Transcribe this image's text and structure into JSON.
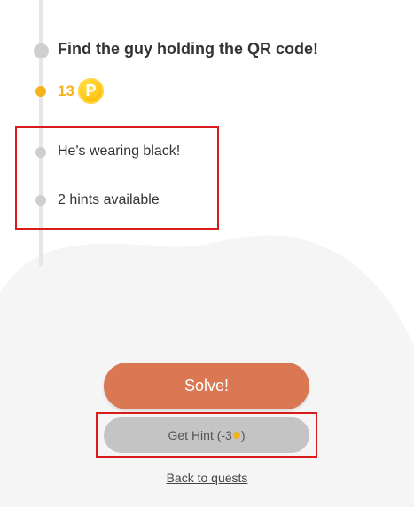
{
  "quest": {
    "task_title": "Find the guy holding the QR code!",
    "coins": "13",
    "coin_icon_glyph": "P"
  },
  "hints": {
    "items": [
      {
        "text": "He's wearing black!"
      },
      {
        "text": "2 hints available"
      }
    ]
  },
  "actions": {
    "solve_label": "Solve!",
    "hint_label_prefix": "Get Hint (-3",
    "hint_label_suffix": ")",
    "back_label": "Back to quests"
  },
  "colors": {
    "accent": "#d97852",
    "coin": "#f5b21a",
    "highlight": "#d81b1b",
    "disabled_button": "#c4c4c4"
  }
}
